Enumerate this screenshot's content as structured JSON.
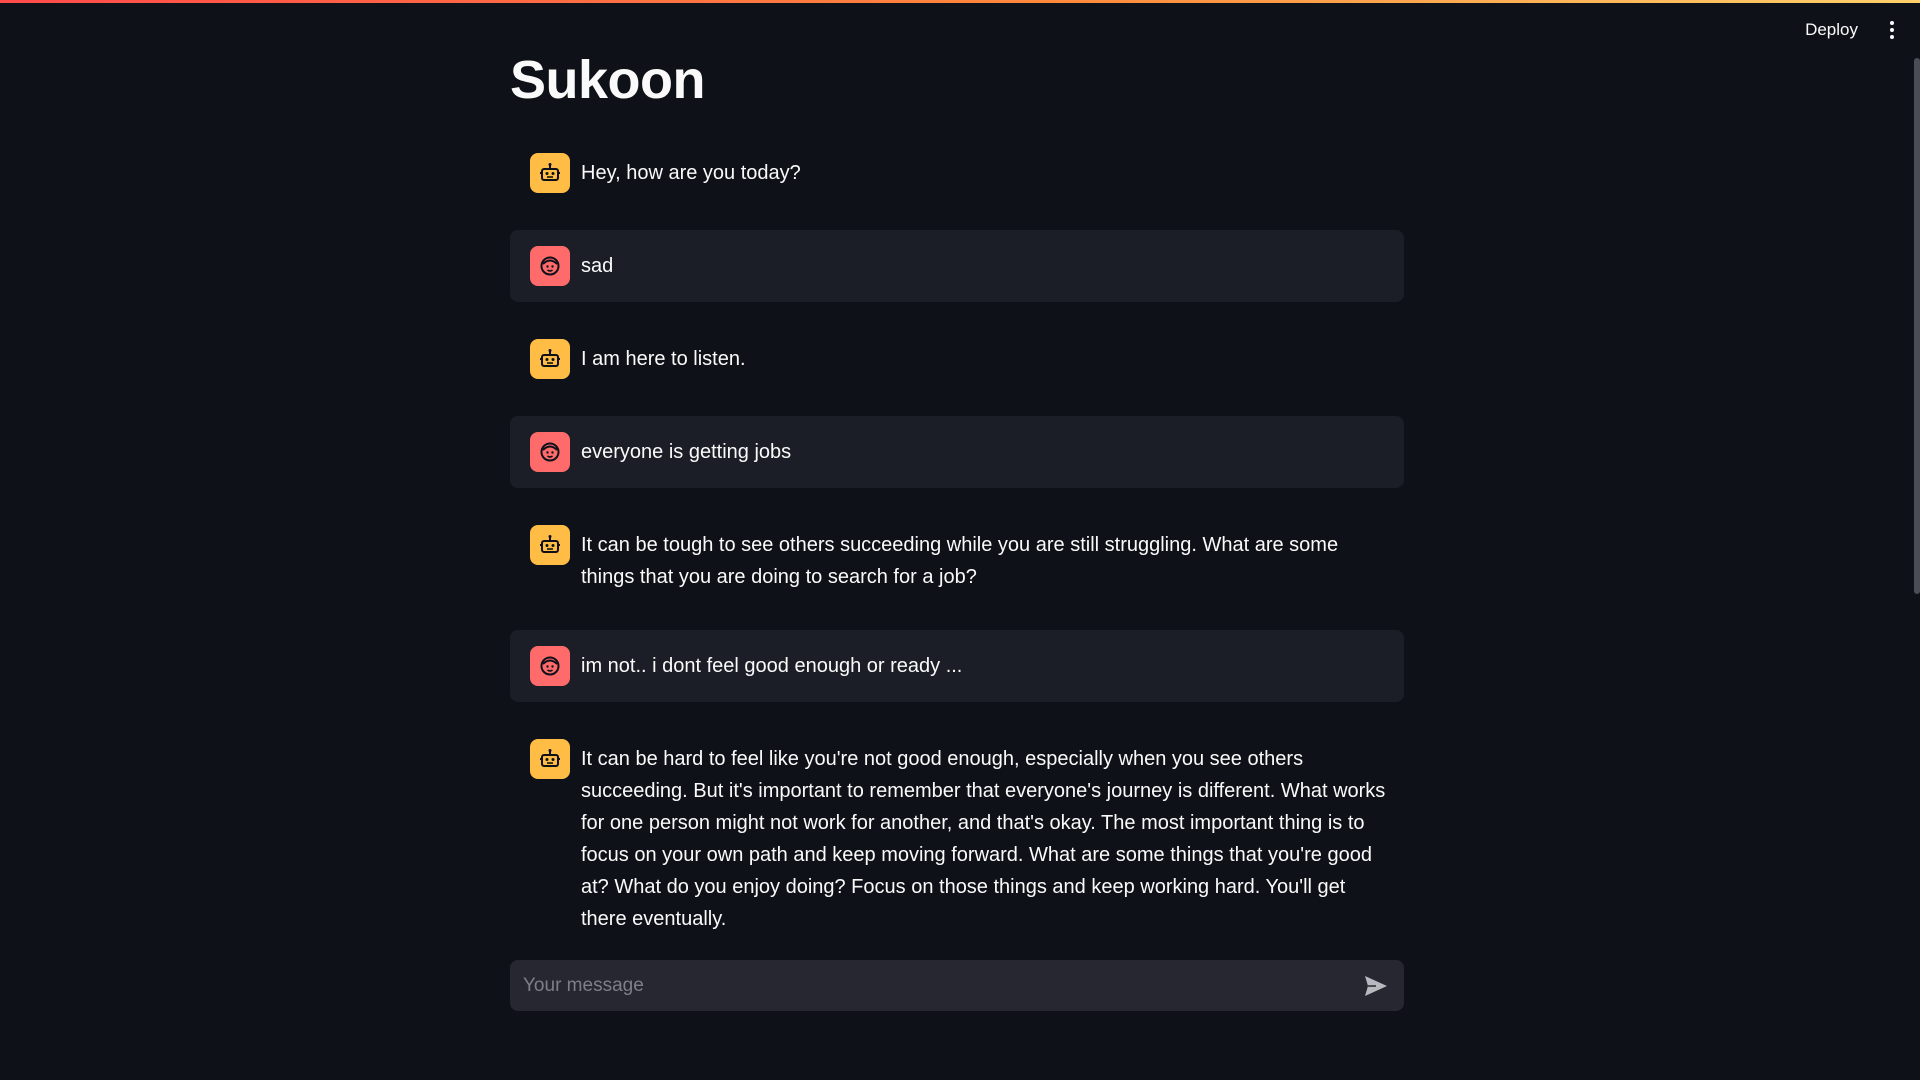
{
  "header": {
    "deploy_label": "Deploy",
    "menu_icon": "kebab-menu-icon"
  },
  "page": {
    "title": "Sukoon"
  },
  "colors": {
    "background": "#0e1117",
    "user_bubble": "#1b1e26",
    "assistant_avatar": "#ffbd45",
    "user_avatar": "#ff6b6b",
    "input_background": "#262730"
  },
  "messages": [
    {
      "role": "assistant",
      "avatar": "robot-icon",
      "text": "Hey, how are you today?"
    },
    {
      "role": "user",
      "avatar": "face-icon",
      "text": "sad"
    },
    {
      "role": "assistant",
      "avatar": "robot-icon",
      "text": "I am here to listen."
    },
    {
      "role": "user",
      "avatar": "face-icon",
      "text": "everyone is getting jobs"
    },
    {
      "role": "assistant",
      "avatar": "robot-icon",
      "text": "It can be tough to see others succeeding while you are still struggling. What are some things that you are doing to search for a job?"
    },
    {
      "role": "user",
      "avatar": "face-icon",
      "text": "im not.. i dont feel good enough or ready ..."
    },
    {
      "role": "assistant",
      "avatar": "robot-icon",
      "text": "It can be hard to feel like you're not good enough, especially when you see others succeeding. But it's important to remember that everyone's journey is different. What works for one person might not work for another, and that's okay. The most important thing is to focus on your own path and keep moving forward. What are some things that you're good at? What do you enjoy doing? Focus on those things and keep working hard. You'll get there eventually."
    }
  ],
  "chat_input": {
    "placeholder": "Your message",
    "value": "",
    "send_icon": "send-icon"
  }
}
